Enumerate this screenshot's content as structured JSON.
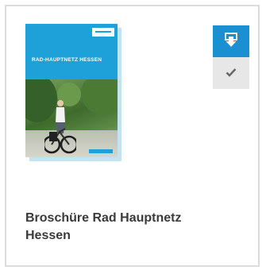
{
  "product": {
    "title": "Broschüre Rad Hauptnetz Hessen",
    "cover": {
      "title": "RAD-HAUPTNETZ HESSEN",
      "image": "brochure-cover-cyclist"
    }
  },
  "actions": {
    "download": {
      "icon": "download-icon"
    },
    "select": {
      "icon": "checkmark-icon"
    }
  },
  "colors": {
    "accent": "#1a8fd1",
    "cover_blue": "#1ea0d8",
    "border": "#dcdcdc",
    "check_bg": "#e7e7e7",
    "title_text": "#3a3a3a"
  }
}
